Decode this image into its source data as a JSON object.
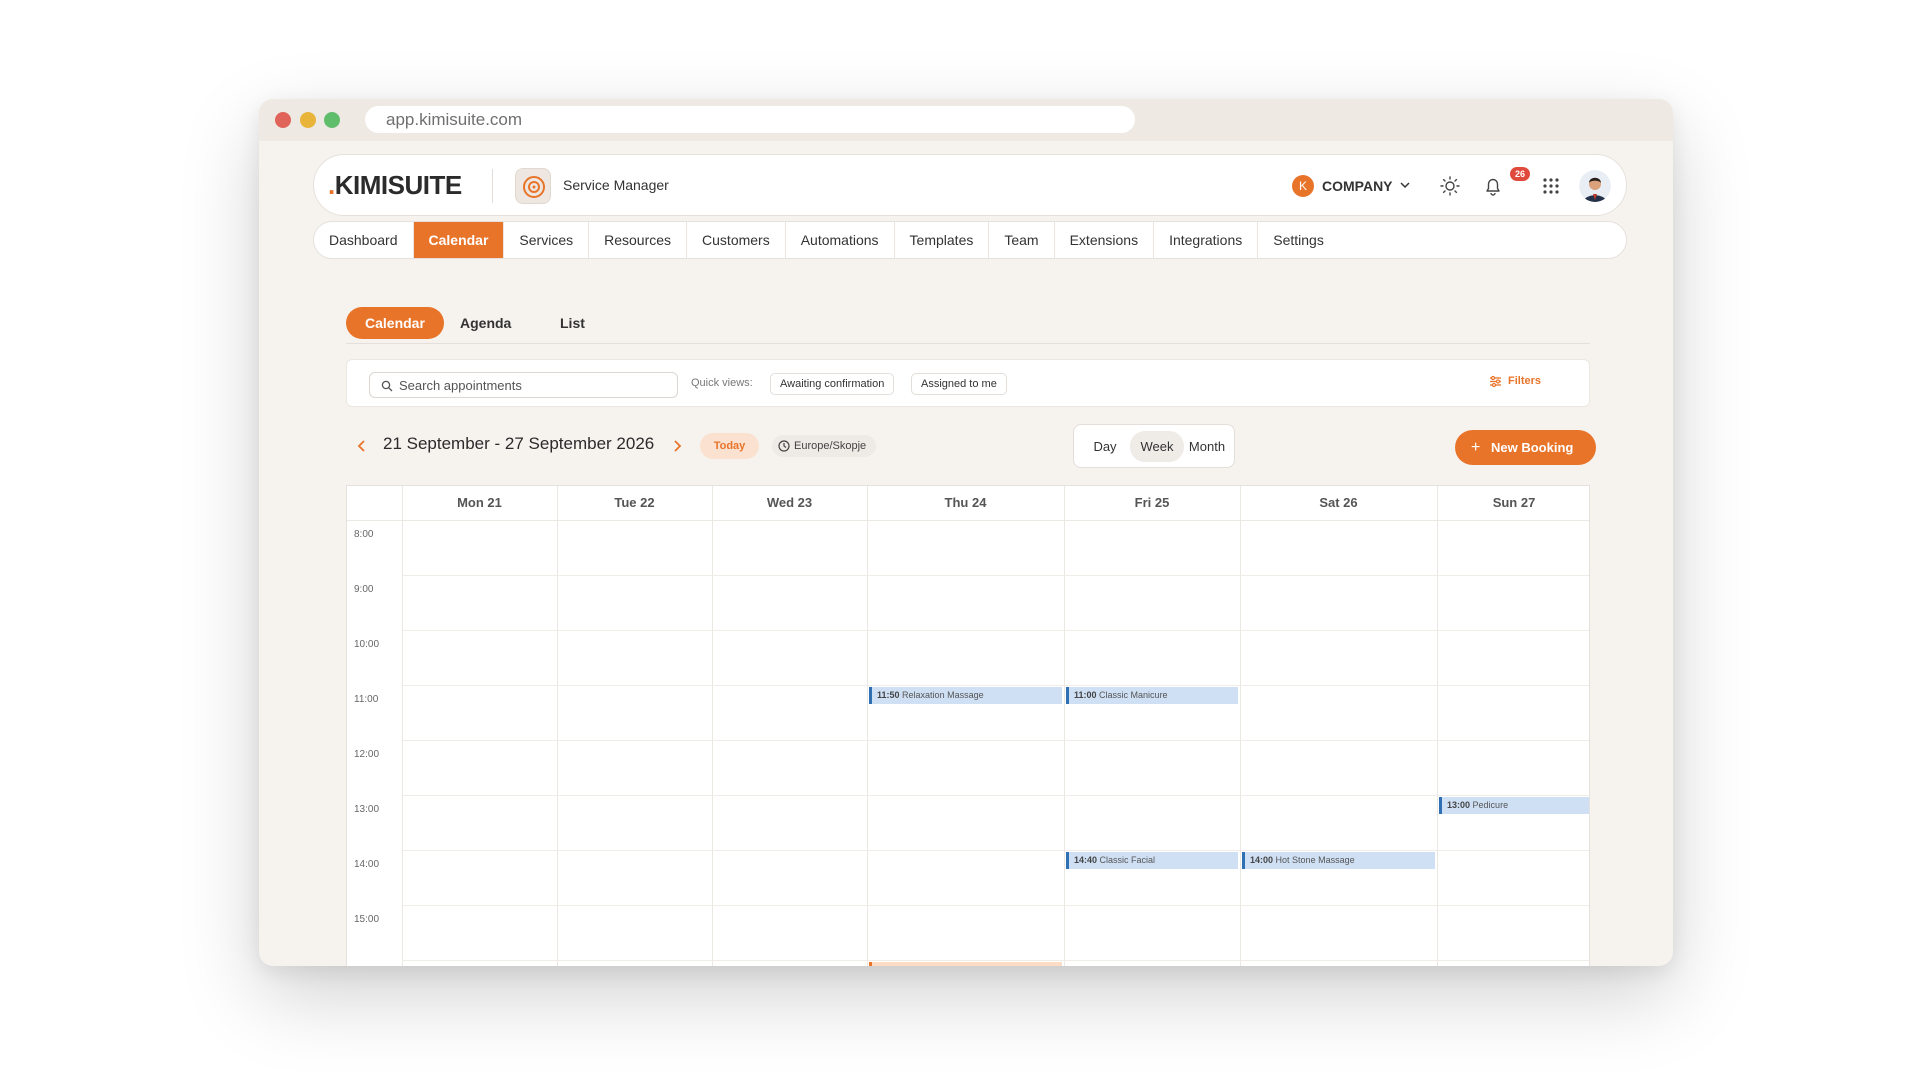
{
  "browser": {
    "url": "app.kimisuite.com"
  },
  "header": {
    "logo": "KIMISUITE",
    "app_name": "Service Manager",
    "company_initial": "K",
    "company_label": "COMPANY",
    "notifications_count": "26",
    "icons": [
      "sun-icon",
      "bell-icon",
      "grid-icon",
      "avatar"
    ]
  },
  "nav": {
    "items": [
      "Dashboard",
      "Calendar",
      "Services",
      "Resources",
      "Customers",
      "Automations",
      "Templates",
      "Team",
      "Extensions",
      "Integrations",
      "Settings"
    ],
    "active": "Calendar"
  },
  "view_tabs": {
    "items": [
      "Calendar",
      "Agenda",
      "List"
    ],
    "active": "Calendar"
  },
  "search": {
    "placeholder": "Search appointments",
    "quick_views_label": "Quick views:",
    "quick_views": [
      "Awaiting confirmation",
      "Assigned to me"
    ],
    "filters_label": "Filters"
  },
  "toolbar": {
    "date_range": "21 September - 27 September 2026",
    "today_label": "Today",
    "timezone": "Europe/Skopje",
    "range_options": [
      "Day",
      "Week",
      "Month"
    ],
    "range_active": "Week",
    "new_booking_label": "New Booking"
  },
  "calendar": {
    "days": [
      "Mon 21",
      "Tue 22",
      "Wed 23",
      "Thu 24",
      "Fri 25",
      "Sat 26",
      "Sun 27"
    ],
    "hours": [
      "8:00",
      "9:00",
      "10:00",
      "11:00",
      "12:00",
      "13:00",
      "14:00",
      "15:00"
    ],
    "events": [
      {
        "day": "Thu 24",
        "time": "11:50",
        "title": "Relaxation Massage"
      },
      {
        "day": "Fri 25",
        "time": "11:00",
        "title": "Classic Manicure"
      },
      {
        "day": "Sun 27",
        "time": "13:00",
        "title": "Pedicure"
      },
      {
        "day": "Fri 25",
        "time": "14:40",
        "title": "Classic Facial"
      },
      {
        "day": "Sat 26",
        "time": "14:00",
        "title": "Hot Stone Massage"
      }
    ]
  },
  "colors": {
    "accent": "#e8742a",
    "event_bg": "#cfe0f5",
    "event_border": "#2f6fb4"
  }
}
